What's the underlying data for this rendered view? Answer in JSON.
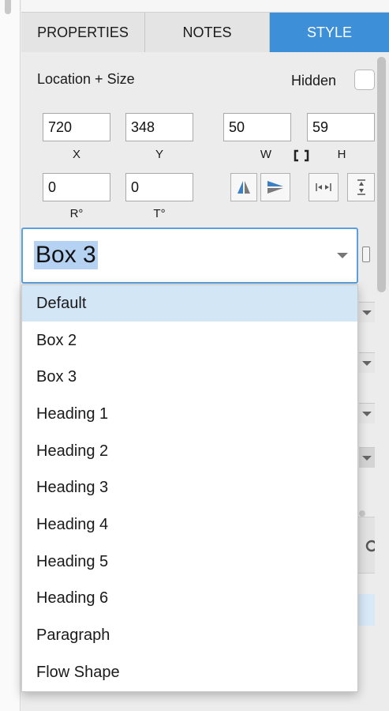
{
  "tabs": [
    "PROPERTIES",
    "NOTES",
    "STYLE"
  ],
  "location_size": {
    "title": "Location + Size",
    "hidden_label": "Hidden"
  },
  "fields": {
    "x": {
      "value": "720",
      "label": "X"
    },
    "y": {
      "value": "348",
      "label": "Y"
    },
    "w": {
      "value": "50",
      "label": "W"
    },
    "h": {
      "value": "59",
      "label": "H"
    },
    "r": {
      "value": "0",
      "label": "R°"
    },
    "t": {
      "value": "0",
      "label": "T°"
    }
  },
  "style_select": {
    "selected": "Box 3"
  },
  "style_options": [
    "Default",
    "Box 2",
    "Box 3",
    "Heading 1",
    "Heading 2",
    "Heading 3",
    "Heading 4",
    "Heading 5",
    "Heading 6",
    "Paragraph",
    "Flow Shape"
  ],
  "highlighted_option": "Default",
  "colors": {
    "active_tab": "#3d8fd8",
    "focus_border": "#5a9fe0",
    "menu_highlight": "#d3e6f6"
  },
  "icons": [
    "lock-size-icon",
    "flip-horizontal-icon",
    "flip-vertical-icon",
    "distribute-horizontal-icon",
    "distribute-vertical-icon",
    "search-icon"
  ]
}
